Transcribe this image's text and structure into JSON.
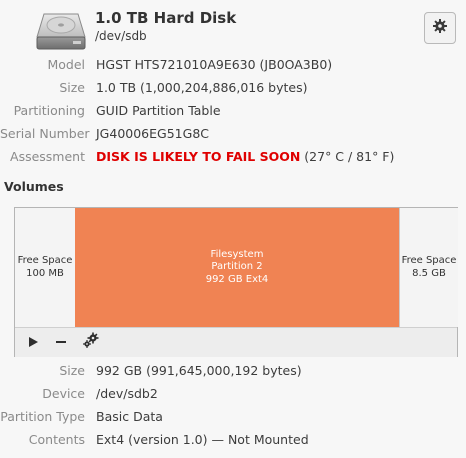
{
  "disk": {
    "title": "1.0 TB Hard Disk",
    "device": "/dev/sdb",
    "icon": "hard-disk-icon",
    "menu_icon": "gear-icon"
  },
  "properties": [
    {
      "label": "Model",
      "value": "HGST HTS721010A9E630 (JB0OA3B0)"
    },
    {
      "label": "Size",
      "value": "1.0 TB (1,000,204,886,016 bytes)"
    },
    {
      "label": "Partitioning",
      "value": "GUID Partition Table"
    },
    {
      "label": "Serial Number",
      "value": "JG40006EG51G8C"
    }
  ],
  "assessment": {
    "label": "Assessment",
    "warning": "DISK IS LIKELY TO FAIL SOON",
    "temperature": " (27° C / 81° F)",
    "warning_color": "#df0000"
  },
  "volumes": {
    "heading": "Volumes",
    "segments": [
      {
        "line1": "Free Space",
        "line2": "100 MB"
      },
      {
        "line1": "Filesystem",
        "line2": "Partition 2",
        "line3": "992 GB Ext4",
        "color": "#f08353"
      },
      {
        "line1": "Free Space",
        "line2": "8.5 GB"
      }
    ],
    "toolbar_icons": [
      "play-icon",
      "minus-icon",
      "gears-icon"
    ]
  },
  "partition_details": [
    {
      "label": "Size",
      "value": "992 GB (991,645,000,192 bytes)"
    },
    {
      "label": "Device",
      "value": "/dev/sdb2"
    },
    {
      "label": "Partition Type",
      "value": "Basic Data"
    },
    {
      "label": "Contents",
      "value": "Ext4 (version 1.0) — Not Mounted"
    }
  ]
}
